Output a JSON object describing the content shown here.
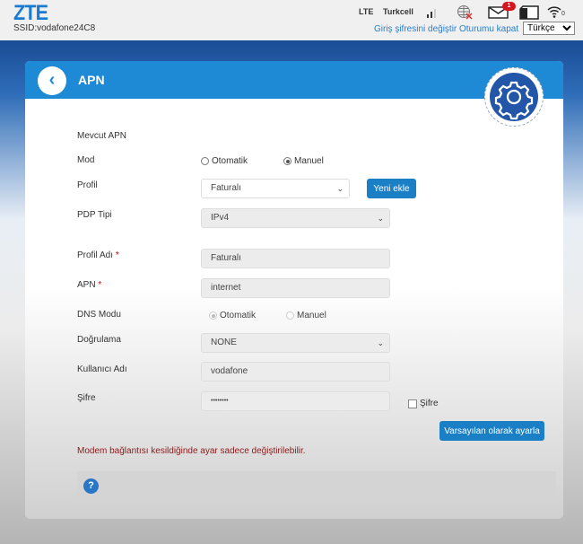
{
  "header": {
    "logo": "ZTE",
    "ssid": "SSID:vodafone24C8",
    "network_type": "LTE",
    "operator": "Turkcell",
    "message_count": "1",
    "wifi_clients": "0",
    "change_password": "Giriş şifresini değiştir",
    "logout": "Oturumu kapat",
    "language": "Türkçe"
  },
  "page": {
    "title": "APN"
  },
  "form": {
    "current_apn_label": "Mevcut APN",
    "mode_label": "Mod",
    "mode_auto": "Otomatik",
    "mode_manual": "Manuel",
    "mode_selected": "Manuel",
    "profile_label": "Profil",
    "profile_value": "Faturalı",
    "add_new": "Yeni ekle",
    "pdp_label": "PDP Tipi",
    "pdp_value": "IPv4",
    "profile_name_label": "Profil Adı",
    "profile_name_value": "Faturalı",
    "apn_label": "APN",
    "apn_value": "internet",
    "required_mark": "*",
    "dns_label": "DNS Modu",
    "dns_auto": "Otomatik",
    "dns_manual": "Manuel",
    "dns_selected": "Otomatik",
    "auth_label": "Doğrulama",
    "auth_value": "NONE",
    "username_label": "Kullanıcı Adı",
    "username_value": "vodafone",
    "password_label": "Şifre",
    "password_value": "••••••••",
    "show_password_label": "Şifre",
    "show_password_checked": false,
    "set_default": "Varsayılan olarak ayarla",
    "warning": "Modem bağlantısı kesildiğinde ayar sadece değiştirilebilir."
  },
  "colors": {
    "accent": "#1e8ad6",
    "button": "#1b7fc6",
    "warning": "#8b1a1a",
    "badge": "#d8141e"
  }
}
